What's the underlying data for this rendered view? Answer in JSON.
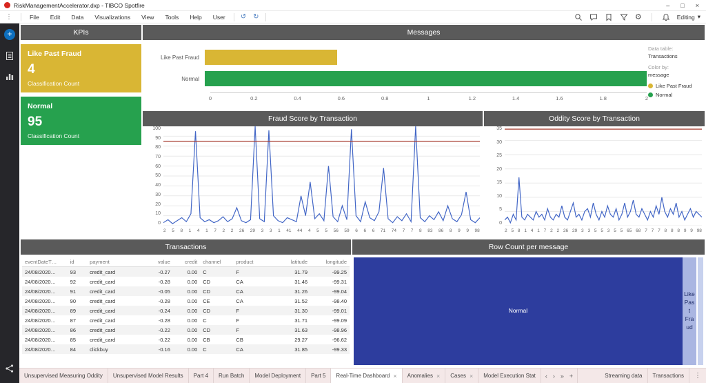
{
  "colors": {
    "yellow": "#d9b634",
    "green": "#26a14e",
    "line_blue": "#4266c6",
    "ref_red": "#a5382b",
    "treemap_main": "#2d3d9e",
    "treemap_small": "#aab6e2",
    "panel_header_bg": "#5a5a5a"
  },
  "titlebar": {
    "title": "RiskManagementAccelerator.dxp - TIBCO Spotfire",
    "minimize": "–",
    "maximize": "□",
    "close": "×"
  },
  "menubar": {
    "items": [
      "File",
      "Edit",
      "Data",
      "Visualizations",
      "View",
      "Tools",
      "Help",
      "User"
    ],
    "undo": "↺",
    "redo": "↻",
    "editing_label": "Editing",
    "editing_chevron": "▾"
  },
  "kpis": {
    "title": "KPIs",
    "cards": [
      {
        "label": "Like Past Fraud",
        "value": "4",
        "sublabel": "Classification Count",
        "color": "#d9b634"
      },
      {
        "label": "Normal",
        "value": "95",
        "sublabel": "Classification Count",
        "color": "#26a14e"
      }
    ]
  },
  "messages": {
    "title": "Messages",
    "chart_data": {
      "type": "bar",
      "orientation": "horizontal",
      "categories": [
        "Like Past Fraud",
        "Normal"
      ],
      "values": [
        0.6,
        2.0
      ],
      "colors": [
        "#d9b634",
        "#26a14e"
      ],
      "xlim": [
        0,
        2
      ],
      "xticks": [
        "0",
        "0.2",
        "0.4",
        "0.6",
        "0.8",
        "1",
        "1.2",
        "1.4",
        "1.6",
        "1.8",
        "2"
      ]
    },
    "info": {
      "data_table_label": "Data table:",
      "data_table_value": "Transactions",
      "color_by_label": "Color by:",
      "color_by_value": "message",
      "legend": [
        {
          "label": "Like Past Fraud",
          "color": "#d9b634"
        },
        {
          "label": "Normal",
          "color": "#26a14e"
        }
      ]
    }
  },
  "fraud_score": {
    "title": "Fraud Score by Transaction",
    "chart_data": {
      "type": "line",
      "ylim": [
        0,
        100
      ],
      "yticks": [
        100,
        90,
        80,
        70,
        60,
        50,
        40,
        30,
        20,
        10,
        0
      ],
      "ref_line": 85,
      "line_color": "#4266c6",
      "ref_color": "#a5382b",
      "values": [
        3,
        6,
        2,
        5,
        8,
        4,
        12,
        95,
        8,
        4,
        6,
        3,
        5,
        9,
        4,
        7,
        18,
        5,
        3,
        6,
        100,
        7,
        4,
        96,
        10,
        5,
        3,
        8,
        6,
        4,
        30,
        10,
        44,
        7,
        12,
        5,
        60,
        9,
        4,
        20,
        6,
        97,
        10,
        4,
        24,
        8,
        5,
        14,
        58,
        7,
        3,
        9,
        5,
        12,
        4,
        100,
        8,
        4,
        10,
        6,
        14,
        5,
        20,
        7,
        4,
        11,
        34,
        6,
        3,
        8
      ],
      "xtick_labels": [
        "2",
        "5",
        "8",
        "1",
        "4",
        "1",
        "7",
        "2",
        "2",
        "26",
        "29",
        "3",
        "3",
        "1",
        "41",
        "44",
        "4",
        "5",
        "5",
        "56",
        "59",
        "6",
        "6",
        "6",
        "71",
        "74",
        "7",
        "7",
        "8",
        "83",
        "86",
        "8",
        "9",
        "9",
        "98"
      ]
    }
  },
  "oddity_score": {
    "title": "Oddity Score by Transaction",
    "chart_data": {
      "type": "line",
      "ylim": [
        0,
        35
      ],
      "yticks": [
        35,
        30,
        25,
        20,
        15,
        10,
        5,
        0
      ],
      "ref_line": 34,
      "line_color": "#4266c6",
      "ref_color": "#a5382b",
      "values": [
        2,
        3,
        1,
        4,
        2,
        17,
        3,
        2,
        4,
        3,
        2,
        5,
        3,
        4,
        2,
        6,
        3,
        2,
        4,
        3,
        7,
        3,
        2,
        5,
        8,
        3,
        4,
        2,
        5,
        6,
        3,
        8,
        4,
        2,
        5,
        3,
        7,
        4,
        3,
        6,
        2,
        4,
        8,
        3,
        5,
        9,
        4,
        3,
        6,
        4,
        2,
        5,
        3,
        7,
        4,
        10,
        5,
        3,
        6,
        4,
        8,
        3,
        5,
        2,
        4,
        6,
        3,
        5,
        4,
        3
      ],
      "xtick_labels": [
        "2",
        "5",
        "8",
        "1",
        "4",
        "1",
        "7",
        "2",
        "2",
        "26",
        "29",
        "3",
        "3",
        "5",
        "5",
        "3",
        "5",
        "5",
        "65",
        "68",
        "7",
        "7",
        "7",
        "8",
        "8",
        "8",
        "9",
        "9",
        "98"
      ]
    }
  },
  "transactions": {
    "title": "Transactions",
    "columns": [
      {
        "label": "eventDateT…",
        "align": "left"
      },
      {
        "label": "id",
        "align": "left"
      },
      {
        "label": "payment",
        "align": "left"
      },
      {
        "label": "value",
        "align": "right"
      },
      {
        "label": "credit",
        "align": "right"
      },
      {
        "label": "channel",
        "align": "left"
      },
      {
        "label": "product",
        "align": "left"
      },
      {
        "label": "latitude",
        "align": "right"
      },
      {
        "label": "longitude",
        "align": "right"
      }
    ],
    "rows": [
      [
        "24/08/2020…",
        "93",
        "credit_card",
        "-0.27",
        "0.00",
        "C",
        "F",
        "31.79",
        "-99.25"
      ],
      [
        "24/08/2020…",
        "92",
        "credit_card",
        "-0.28",
        "0.00",
        "CD",
        "CA",
        "31.46",
        "-99.31"
      ],
      [
        "24/08/2020…",
        "91",
        "credit_card",
        "-0.05",
        "0.00",
        "CD",
        "CA",
        "31.26",
        "-99.04"
      ],
      [
        "24/08/2020…",
        "90",
        "credit_card",
        "-0.28",
        "0.00",
        "CE",
        "CA",
        "31.52",
        "-98.40"
      ],
      [
        "24/08/2020…",
        "89",
        "credit_card",
        "-0.24",
        "0.00",
        "CD",
        "F",
        "31.30",
        "-99.01"
      ],
      [
        "24/08/2020…",
        "87",
        "credit_card",
        "-0.28",
        "0.00",
        "C",
        "F",
        "31.71",
        "-99.09"
      ],
      [
        "24/08/2020…",
        "86",
        "credit_card",
        "-0.22",
        "0.00",
        "CD",
        "F",
        "31.63",
        "-98.96"
      ],
      [
        "24/08/2020…",
        "85",
        "credit_card",
        "-0.22",
        "0.00",
        "CB",
        "CB",
        "29.27",
        "-96.62"
      ],
      [
        "24/08/2020…",
        "84",
        "clickbuy",
        "-0.16",
        "0.00",
        "C",
        "CA",
        "31.85",
        "-99.33"
      ]
    ]
  },
  "row_count": {
    "title": "Row Count per message",
    "chart_data": {
      "type": "treemap",
      "items": [
        {
          "label": "Normal",
          "value": 95,
          "color": "#2d3d9e",
          "text_color": "#ffffff"
        },
        {
          "label": "Like Past Fraud",
          "value": 4,
          "color": "#aab6e2",
          "text_color": "#1d2a66"
        }
      ]
    }
  },
  "tabs": {
    "left": [
      {
        "label": "Unsupervised Measuring Oddity",
        "active": false,
        "closable": false
      },
      {
        "label": "Unsupervised Model Results",
        "active": false,
        "closable": false
      },
      {
        "label": "Part 4",
        "active": false,
        "closable": false
      },
      {
        "label": "Run Batch",
        "active": false,
        "closable": false
      },
      {
        "label": "Model Deployment",
        "active": false,
        "closable": false
      },
      {
        "label": "Part 5",
        "active": false,
        "closable": false
      },
      {
        "label": "Real-Time Dashboard",
        "active": true,
        "closable": true
      },
      {
        "label": "Anomalies",
        "active": false,
        "closable": true
      },
      {
        "label": "Cases",
        "active": false,
        "closable": true
      },
      {
        "label": "Model Execution Stat",
        "active": false,
        "closable": false
      }
    ],
    "nav": [
      {
        "glyph": "‹",
        "name": "tab-nav-back"
      },
      {
        "glyph": "›",
        "name": "tab-nav-forward"
      },
      {
        "glyph": "»",
        "name": "tab-nav-last"
      },
      {
        "glyph": "+",
        "name": "tab-add"
      }
    ],
    "right": [
      {
        "label": "Streaming data"
      },
      {
        "label": "Transactions"
      }
    ],
    "overflow": "⋮"
  }
}
